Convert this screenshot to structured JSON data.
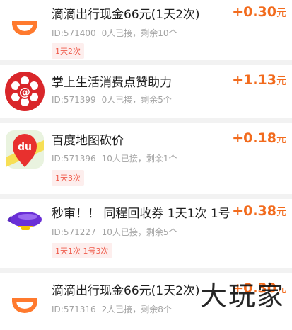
{
  "items": [
    {
      "title": "滴滴出行现金66元(1天2次)",
      "id_text": "ID:571400",
      "accepted": "0人已接，",
      "remaining": "剩余10个",
      "tag": "1天2次",
      "price": "+0.30",
      "unit": "元",
      "icon": "didi-logo-icon"
    },
    {
      "title": "掌上生活消费点赞助力",
      "id_text": "ID:571399",
      "accepted": "0人已接，",
      "remaining": "剩余5个",
      "tag": "",
      "price": "+1.13",
      "unit": "元",
      "icon": "cmb-life-logo-icon"
    },
    {
      "title": "百度地图砍价",
      "id_text": "ID:571396",
      "accepted": "10人已接，",
      "remaining": "剩余1个",
      "tag": "1天3次",
      "price": "+0.18",
      "unit": "元",
      "icon": "baidu-map-logo-icon"
    },
    {
      "title": "秒审！！ 同程回收券 1天1次 1号",
      "id_text": "ID:571227",
      "accepted": "10人已接，",
      "remaining": "剩余5个",
      "tag": "1天1次 1号3次",
      "price": "+0.38",
      "unit": "元",
      "icon": "tongcheng-blimp-logo-icon"
    },
    {
      "title": "滴滴出行现金66元(1天2次)",
      "id_text": "ID:571316",
      "accepted": "2人已接，",
      "remaining": "剩余8个",
      "tag": "",
      "price": "+0.30",
      "unit": "元",
      "icon": "didi-logo-icon"
    }
  ],
  "watermark": "大玩家",
  "colors": {
    "price": "#f26b1d",
    "tag_text": "#ef5b4b",
    "tag_bg": "#fdeeed",
    "separator": "#f2f2f2"
  }
}
